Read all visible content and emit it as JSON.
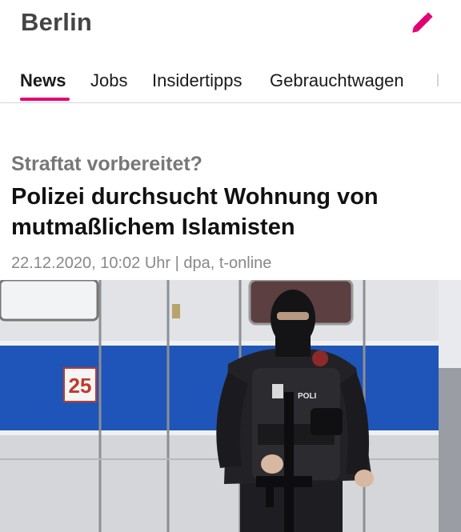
{
  "header": {
    "city": "Berlin",
    "edit_icon": "pencil-icon",
    "accent_color": "#e20074"
  },
  "tabs": [
    {
      "label": "News",
      "active": true
    },
    {
      "label": "Jobs",
      "active": false
    },
    {
      "label": "Insidertipps",
      "active": false
    },
    {
      "label": "Gebrauchtwagen",
      "active": false
    },
    {
      "label": "I",
      "active": false
    }
  ],
  "article": {
    "kicker": "Straftat vorbereitet?",
    "headline": "Polizei durchsucht Wohnung von mutmaßlichem Islamisten",
    "meta": "22.12.2020, 10:02 Uhr | dpa, t-online",
    "image": {
      "van_number": "25",
      "vest_label": "POLI"
    }
  }
}
